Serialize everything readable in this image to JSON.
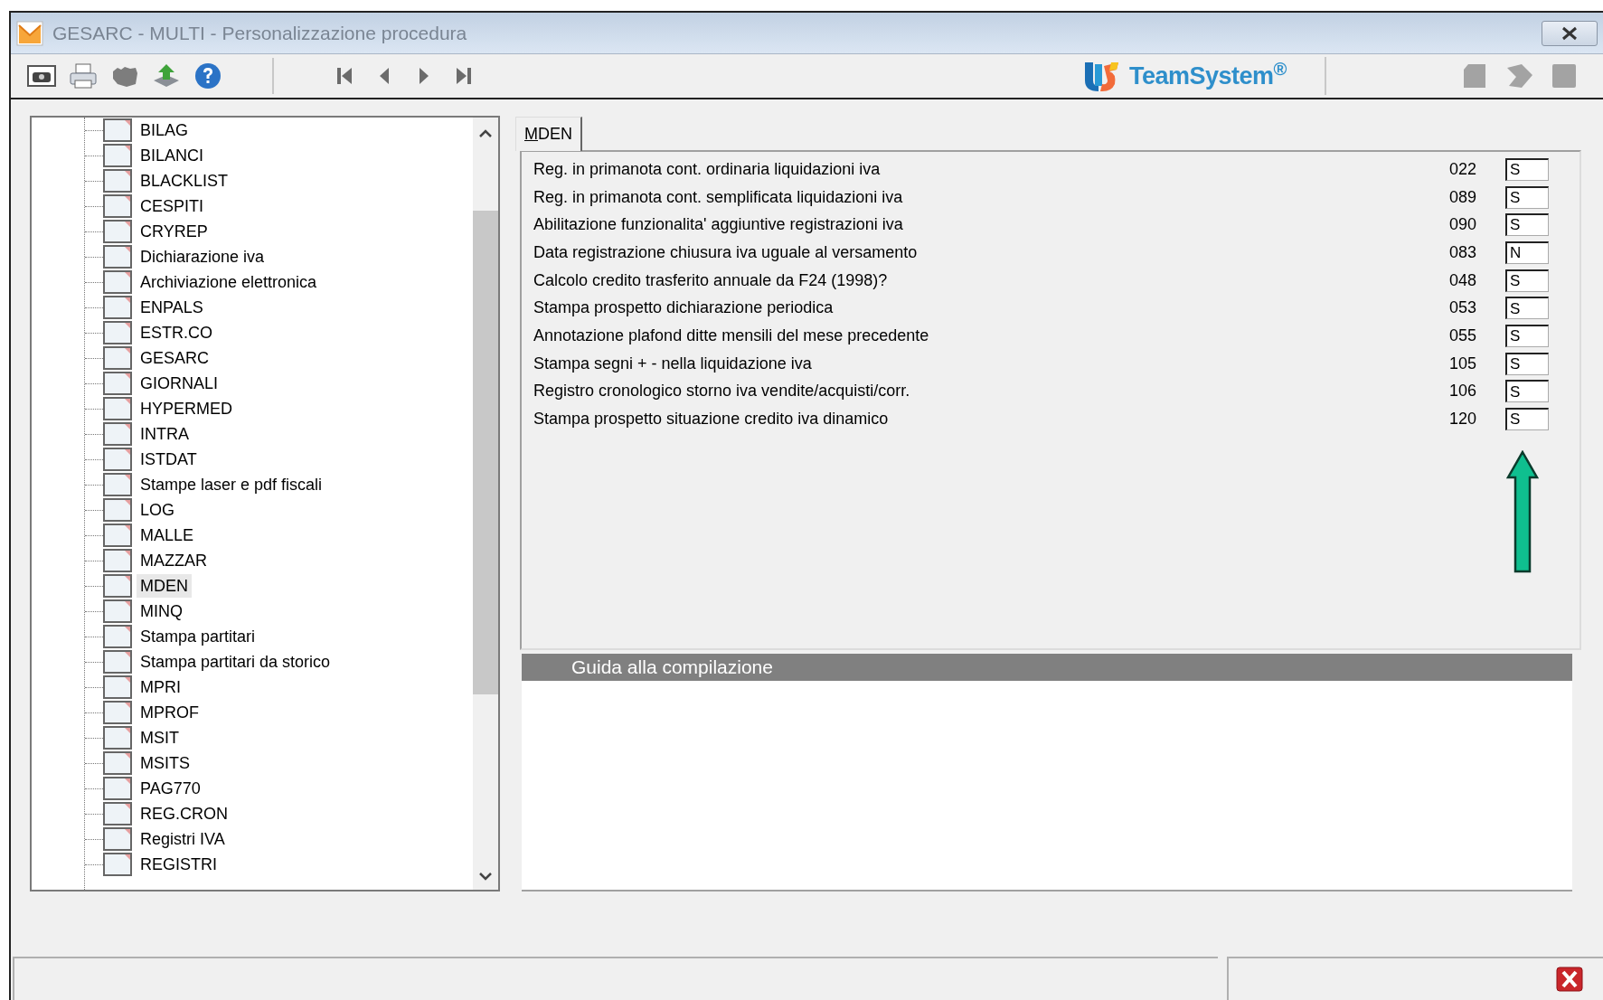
{
  "window": {
    "title": "GESARC  - MULTI -  Personalizzazione procedura"
  },
  "logo": {
    "text": "TeamSystem$^{®}$"
  },
  "tree": {
    "items": [
      {
        "label": "BILAG",
        "selected": false
      },
      {
        "label": "BILANCI",
        "selected": false
      },
      {
        "label": "BLACKLIST",
        "selected": false
      },
      {
        "label": "CESPITI",
        "selected": false
      },
      {
        "label": "CRYREP",
        "selected": false
      },
      {
        "label": "Dichiarazione iva",
        "selected": false
      },
      {
        "label": "Archiviazione elettronica",
        "selected": false
      },
      {
        "label": "ENPALS",
        "selected": false
      },
      {
        "label": "ESTR.CO",
        "selected": false
      },
      {
        "label": "GESARC",
        "selected": false
      },
      {
        "label": "GIORNALI",
        "selected": false
      },
      {
        "label": "HYPERMED",
        "selected": false
      },
      {
        "label": "INTRA",
        "selected": false
      },
      {
        "label": "ISTDAT",
        "selected": false
      },
      {
        "label": "Stampe laser e pdf fiscali",
        "selected": false
      },
      {
        "label": "LOG",
        "selected": false
      },
      {
        "label": "MALLE",
        "selected": false
      },
      {
        "label": "MAZZAR",
        "selected": false
      },
      {
        "label": "MDEN",
        "selected": true
      },
      {
        "label": "MINQ",
        "selected": false
      },
      {
        "label": "Stampa partitari",
        "selected": false
      },
      {
        "label": "Stampa partitari da storico",
        "selected": false
      },
      {
        "label": "MPRI",
        "selected": false
      },
      {
        "label": "MPROF",
        "selected": false
      },
      {
        "label": "MSIT",
        "selected": false
      },
      {
        "label": "MSITS",
        "selected": false
      },
      {
        "label": "PAG770",
        "selected": false
      },
      {
        "label": "REG.CRON",
        "selected": false
      },
      {
        "label": "Registri IVA",
        "selected": false
      },
      {
        "label": "REGISTRI",
        "selected": false
      }
    ]
  },
  "tabs": [
    {
      "label": "MDEN",
      "selected": true
    }
  ],
  "settings": [
    {
      "label": "Reg. in primanota cont. ordinaria liquidazioni iva",
      "code": "022",
      "value": "S"
    },
    {
      "label": "Reg. in primanota cont. semplificata liquidazioni iva",
      "code": "089",
      "value": "S"
    },
    {
      "label": "Abilitazione funzionalita' aggiuntive registrazioni iva",
      "code": "090",
      "value": "S"
    },
    {
      "label": "Data registrazione chiusura iva uguale al versamento",
      "code": "083",
      "value": "N"
    },
    {
      "label": "Calcolo credito trasferito annuale da F24 (1998)?",
      "code": "048",
      "value": "S"
    },
    {
      "label": "Stampa prospetto dichiarazione periodica",
      "code": "053",
      "value": "S"
    },
    {
      "label": "Annotazione plafond ditte mensili del mese precedente",
      "code": "055",
      "value": "S"
    },
    {
      "label": "Stampa segni + - nella liquidazione iva",
      "code": "105",
      "value": "S"
    },
    {
      "label": "Registro cronologico storno iva vendite/acquisti/corr.",
      "code": "106",
      "value": "S"
    },
    {
      "label": "Stampa prospetto situazione credito iva dinamico",
      "code": "120",
      "value": "S"
    }
  ],
  "guide": {
    "title": "Guida alla compilazione"
  }
}
